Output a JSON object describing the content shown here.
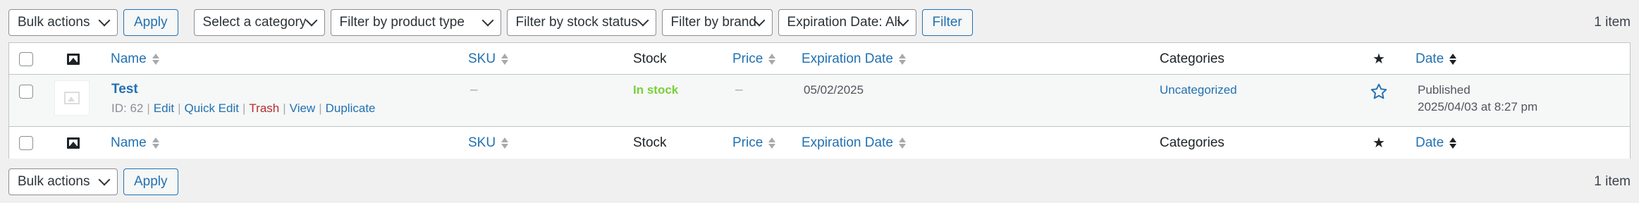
{
  "nav_top": {
    "bulk_actions": "Bulk actions",
    "apply": "Apply",
    "filters": {
      "category": "Select a category",
      "product_type": "Filter by product type",
      "stock_status": "Filter by stock status",
      "brand": "Filter by brand",
      "expiration": "Expiration Date: All"
    },
    "filter_button": "Filter",
    "items_count": "1 item"
  },
  "columns": {
    "name": "Name",
    "sku": "SKU",
    "stock": "Stock",
    "price": "Price",
    "expiration_date": "Expiration Date",
    "categories": "Categories",
    "date": "Date"
  },
  "rows": [
    {
      "name": "Test",
      "id_label": "ID: 62",
      "actions": {
        "edit": "Edit",
        "quick_edit": "Quick Edit",
        "trash": "Trash",
        "view": "View",
        "duplicate": "Duplicate"
      },
      "sku": "–",
      "stock": "In stock",
      "price": "–",
      "expiration_date": "05/02/2025",
      "category": "Uncategorized",
      "status": "Published",
      "date": "2025/04/03 at 8:27 pm"
    }
  ],
  "nav_bottom": {
    "bulk_actions": "Bulk actions",
    "apply": "Apply",
    "items_count": "1 item"
  },
  "colors": {
    "link": "#2271b1",
    "in_stock": "#7ad03a",
    "trash": "#b32d2e",
    "background": "#f0f0f1"
  }
}
